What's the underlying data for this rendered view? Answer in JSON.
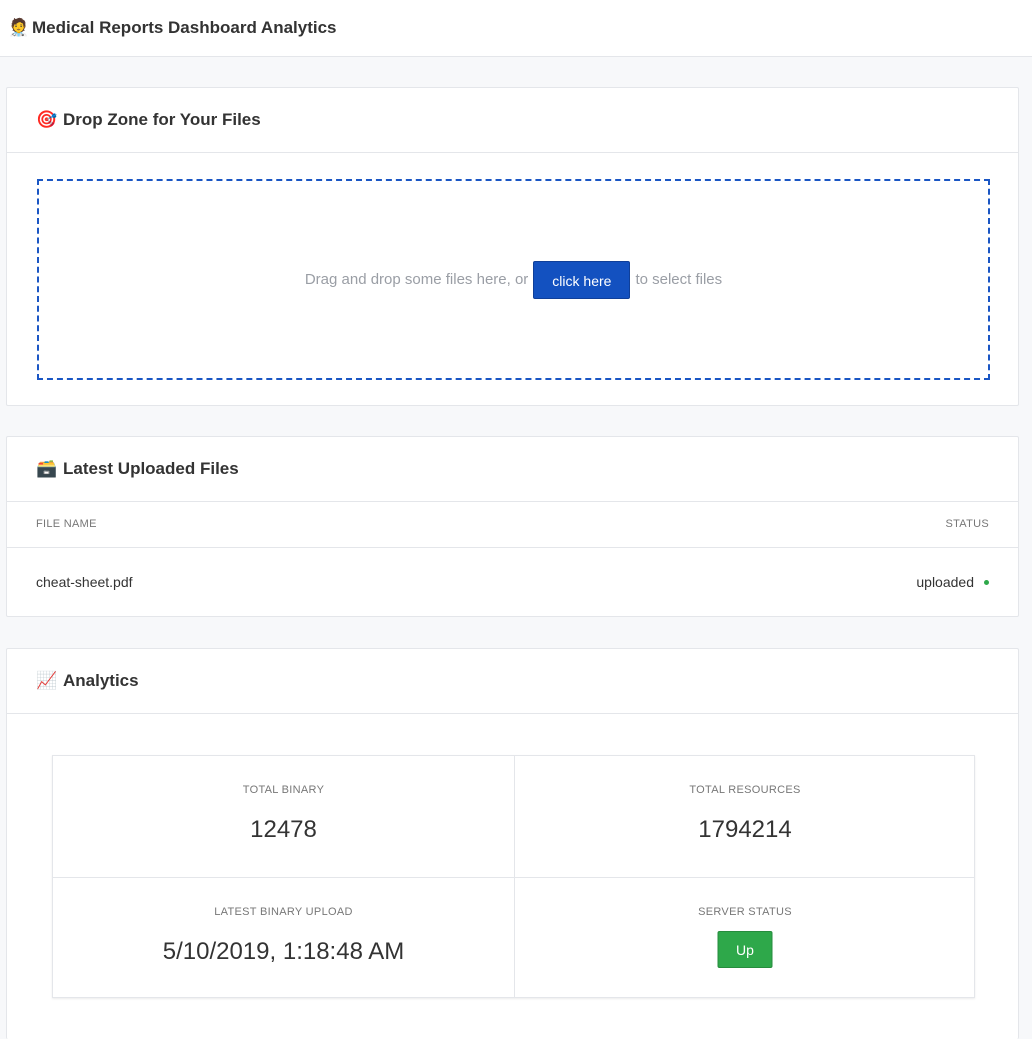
{
  "app": {
    "icon": "doctor-emoji",
    "emoji": "🧑‍⚕️",
    "title": "Medical Reports Dashboard Analytics"
  },
  "dropzone": {
    "icon": "target-emoji",
    "emoji": "🎯",
    "title": "Drop Zone for Your Files",
    "text_before": "Drag and drop some files here, or",
    "button_label": "click here",
    "text_after": "to select files",
    "border_color": "#1a56c4",
    "button_color": "#1351c0"
  },
  "files": {
    "icon": "file-box-emoji",
    "emoji": "🗃️",
    "title": "Latest Uploaded Files",
    "columns": [
      "FILE NAME",
      "STATUS"
    ],
    "rows": [
      {
        "name": "cheat-sheet.pdf",
        "status": "uploaded",
        "status_color": "#2ea84a"
      }
    ]
  },
  "analytics": {
    "icon": "chart-increasing-emoji",
    "emoji": "📈",
    "title": "Analytics",
    "stats": {
      "total_binary": {
        "label": "TOTAL BINARY",
        "value": "12478"
      },
      "total_resources": {
        "label": "TOTAL RESOURCES",
        "value": "1794214"
      },
      "latest_upload": {
        "label": "LATEST BINARY UPLOAD",
        "value": "5/10/2019, 1:18:48 AM"
      },
      "server_status": {
        "label": "SERVER STATUS",
        "value": "Up",
        "color": "#2ea84a"
      }
    }
  }
}
